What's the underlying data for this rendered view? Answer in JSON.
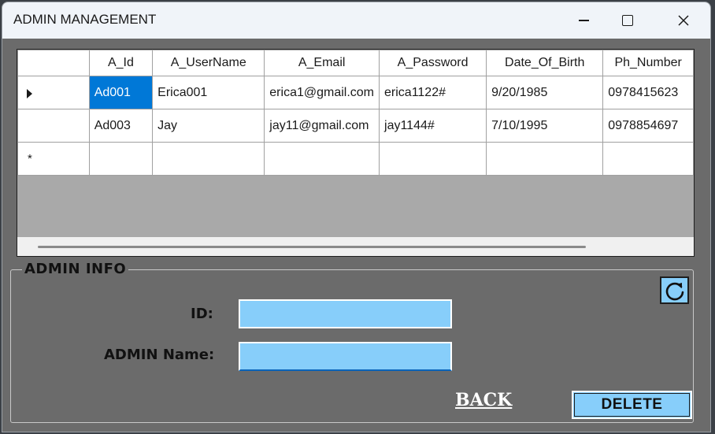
{
  "window": {
    "title": "ADMIN MANAGEMENT"
  },
  "grid": {
    "columns": [
      "A_Id",
      "A_UserName",
      "A_Email",
      "A_Password",
      "Date_Of_Birth",
      "Ph_Number"
    ],
    "rows": [
      {
        "cells": [
          "Ad001",
          "Erica001",
          "erica1@gmail.com",
          "erica1122#",
          "9/20/1985",
          "0978415623"
        ],
        "selected_cell": 0,
        "current": true
      },
      {
        "cells": [
          "Ad003",
          "Jay",
          "jay11@gmail.com",
          "jay1144#",
          "7/10/1995",
          "0978854697"
        ]
      }
    ],
    "new_row_marker": "*"
  },
  "admin_info": {
    "group_title": "ADMIN INFO",
    "id_label": "ID:",
    "id_value": "",
    "name_label": "ADMIN Name:",
    "name_value": "",
    "back_label": "BACK",
    "delete_label": "DELETE",
    "refresh_icon": "refresh-icon"
  },
  "colors": {
    "form_bg": "#6b6b6b",
    "field_bg": "#87cefa",
    "selection": "#0078d7"
  }
}
